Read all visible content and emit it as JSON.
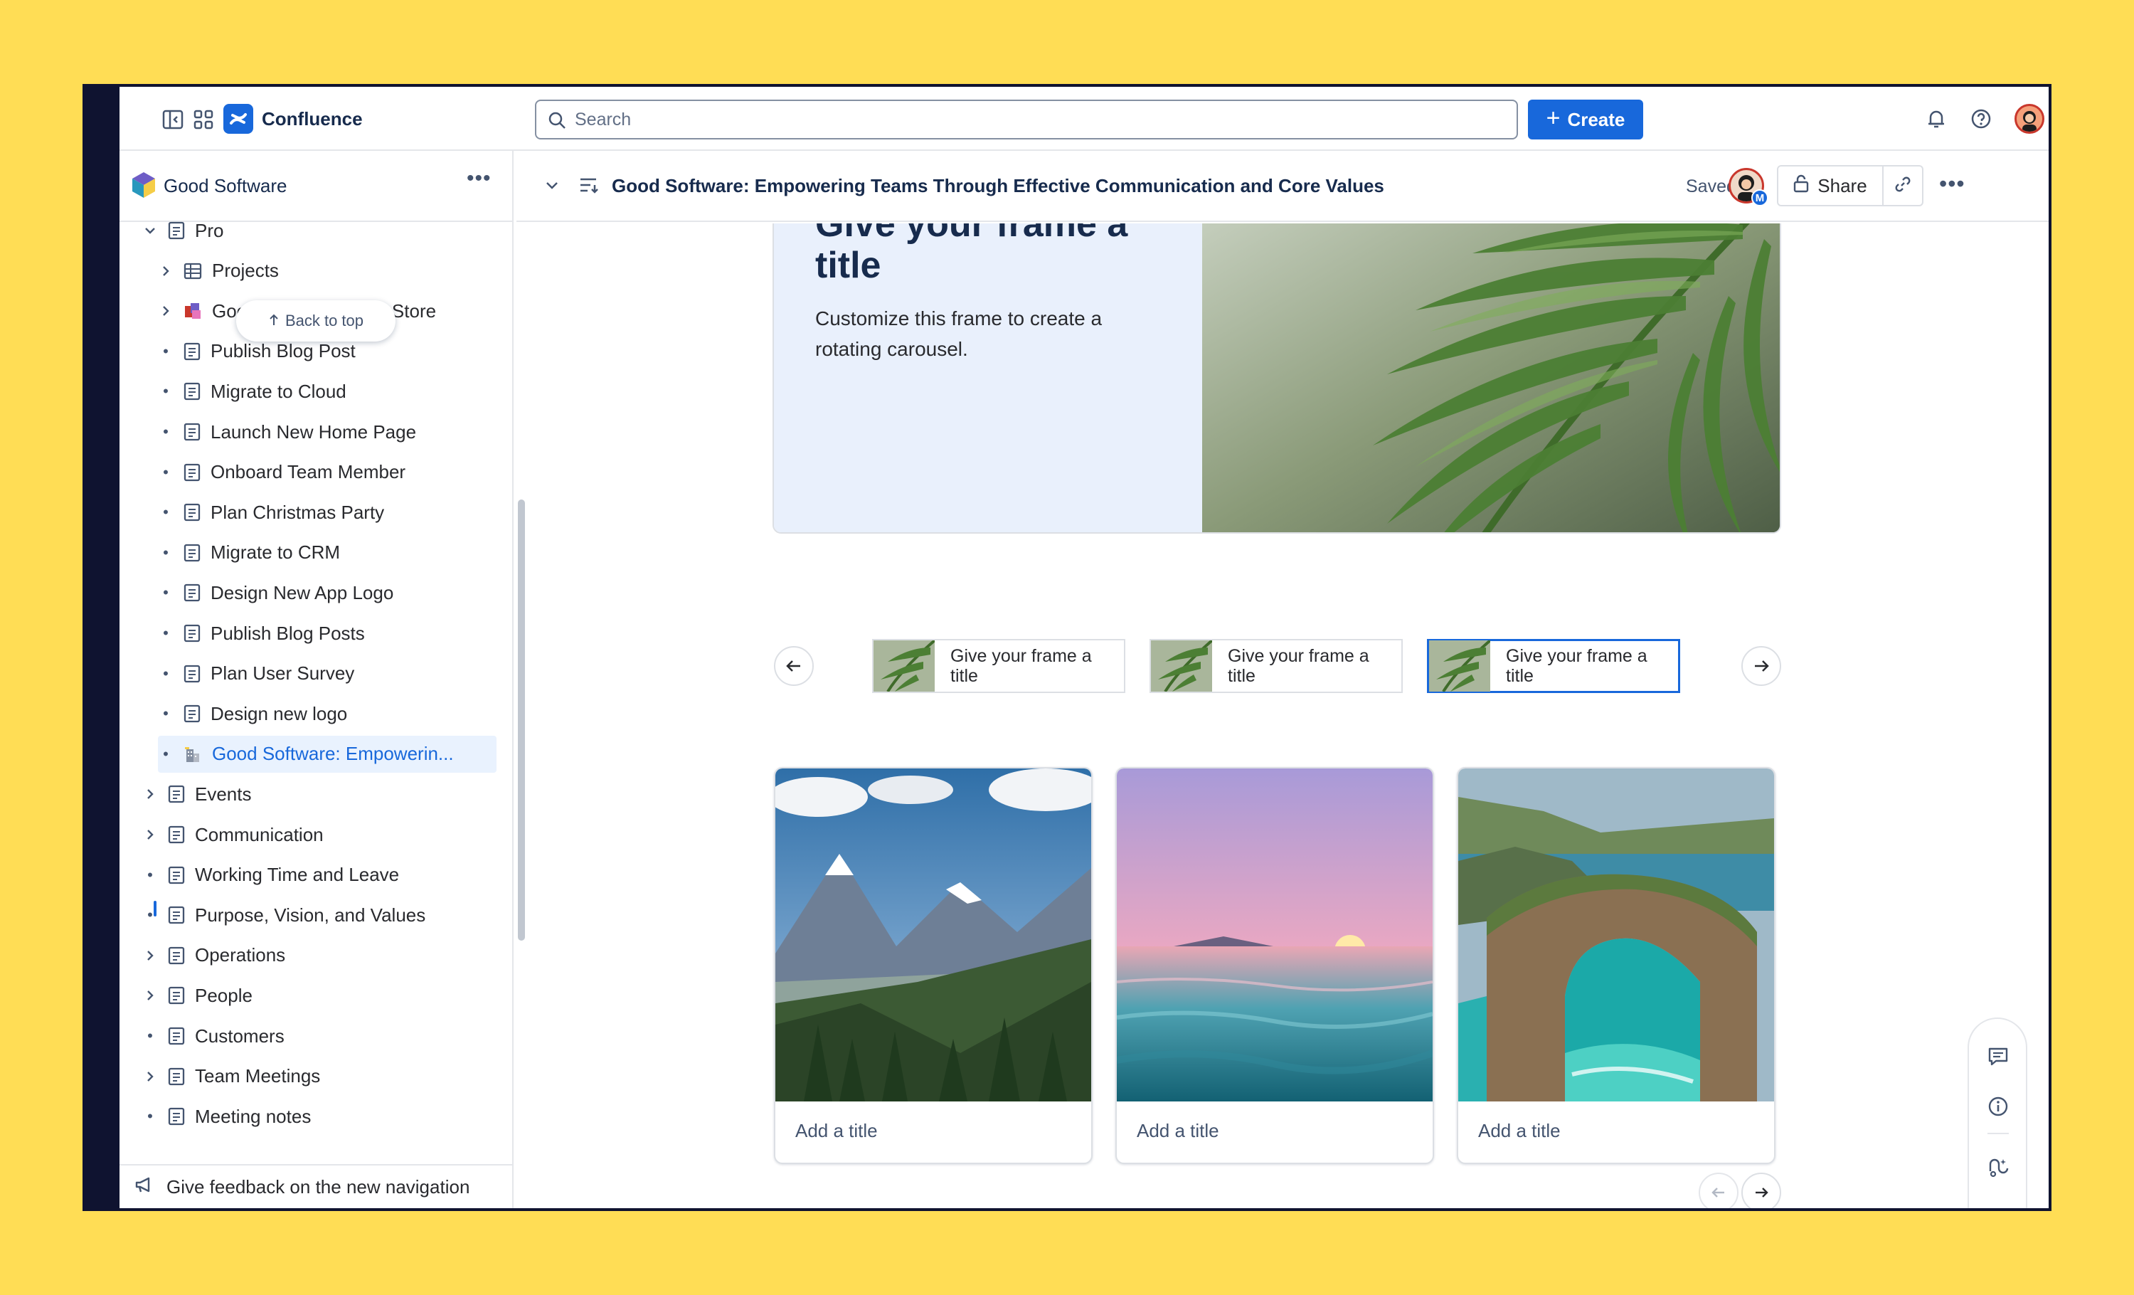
{
  "app": {
    "brand": "Confluence",
    "search_placeholder": "Search",
    "create_label": "Create"
  },
  "sidebar": {
    "space_name": "Good Software",
    "back_to_top": "Back to top",
    "items": [
      {
        "label": "Pro",
        "kind": "page",
        "level": 0,
        "expand": "open"
      },
      {
        "label": "Projects",
        "kind": "database",
        "level": 1,
        "expand": "closed"
      },
      {
        "label": "Good Software Swag Store",
        "kind": "whiteboard",
        "level": 1,
        "expand": "closed"
      },
      {
        "label": "Publish Blog Post",
        "kind": "page",
        "level": 1,
        "expand": "dot"
      },
      {
        "label": "Migrate to Cloud",
        "kind": "page",
        "level": 1,
        "expand": "dot"
      },
      {
        "label": "Launch New Home Page",
        "kind": "page",
        "level": 1,
        "expand": "dot"
      },
      {
        "label": "Onboard Team Member",
        "kind": "page",
        "level": 1,
        "expand": "dot"
      },
      {
        "label": "Plan Christmas Party",
        "kind": "page",
        "level": 1,
        "expand": "dot"
      },
      {
        "label": "Migrate to CRM",
        "kind": "page",
        "level": 1,
        "expand": "dot"
      },
      {
        "label": "Design New App Logo",
        "kind": "page",
        "level": 1,
        "expand": "dot"
      },
      {
        "label": "Publish Blog Posts",
        "kind": "page",
        "level": 1,
        "expand": "dot"
      },
      {
        "label": "Plan User Survey",
        "kind": "page",
        "level": 1,
        "expand": "dot"
      },
      {
        "label": "Design new logo",
        "kind": "page",
        "level": 1,
        "expand": "dot"
      },
      {
        "label": "Good Software: Empowerin...",
        "kind": "building",
        "level": 1,
        "expand": "dot",
        "selected": true
      },
      {
        "label": "Events",
        "kind": "page",
        "level": 0,
        "expand": "closed"
      },
      {
        "label": "Communication",
        "kind": "page",
        "level": 0,
        "expand": "closed"
      },
      {
        "label": "Working Time and Leave",
        "kind": "page",
        "level": 0,
        "expand": "dot"
      },
      {
        "label": "Purpose, Vision, and Values",
        "kind": "page",
        "level": 0,
        "expand": "dot"
      },
      {
        "label": "Operations",
        "kind": "page",
        "level": 0,
        "expand": "closed"
      },
      {
        "label": "People",
        "kind": "page",
        "level": 0,
        "expand": "closed"
      },
      {
        "label": "Customers",
        "kind": "page",
        "level": 0,
        "expand": "dot"
      },
      {
        "label": "Team Meetings",
        "kind": "page",
        "level": 0,
        "expand": "closed"
      },
      {
        "label": "Meeting notes",
        "kind": "page",
        "level": 0,
        "expand": "dot"
      }
    ],
    "feedback": "Give feedback on the new navigation"
  },
  "page": {
    "title": "Good Software: Empowering Teams Through Effective Communication and Core Values",
    "status": "Saved",
    "share_label": "Share",
    "avatar_badge": "M"
  },
  "carousel": {
    "frame_title": "Give your frame a title",
    "frame_desc": "Customize this frame to create a rotating carousel.",
    "thumbs": [
      {
        "label": "Give your frame a title"
      },
      {
        "label": "Give your frame a title"
      },
      {
        "label": "Give your frame a title",
        "active": true
      }
    ]
  },
  "cards": [
    {
      "label": "Add a title",
      "image": "mountain-valley"
    },
    {
      "label": "Add a title",
      "image": "ocean-sunset"
    },
    {
      "label": "Add a title",
      "image": "sea-arch"
    }
  ],
  "colors": {
    "accent": "#1868DB",
    "background": "#FFDD55",
    "selected_bg": "#E9F2FE"
  }
}
